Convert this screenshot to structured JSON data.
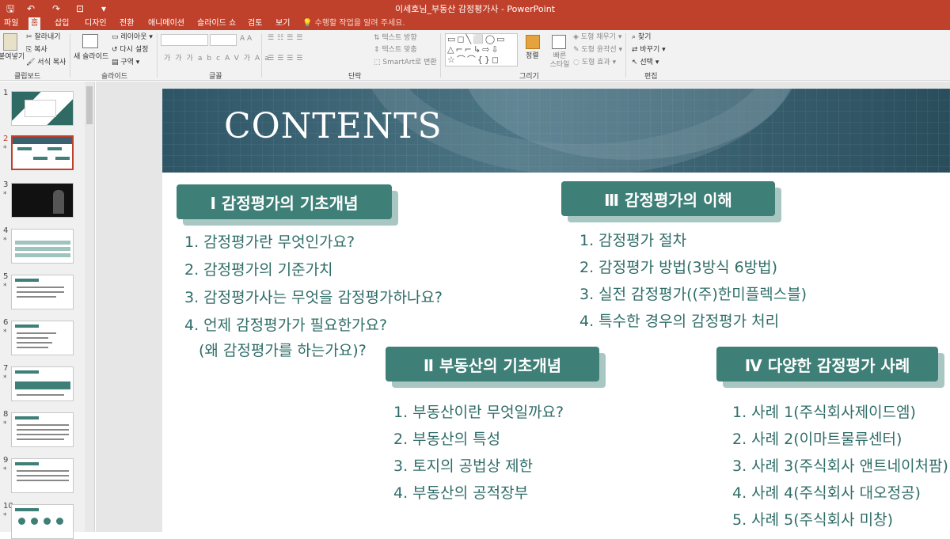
{
  "titlebar": {
    "title": "이세호님_부동산 감정평가사 - PowerPoint",
    "save_icon": "save-icon",
    "undo_icon": "undo-icon",
    "redo_icon": "redo-icon",
    "customize_icon": "customize-icon"
  },
  "tabs": [
    "파일",
    "홈",
    "삽입",
    "디자인",
    "전환",
    "애니메이션",
    "슬라이드 쇼",
    "검토",
    "보기"
  ],
  "tell_me": "수행할 작업을 알려 주세요.",
  "ribbon": {
    "clipboard": {
      "paste": "붙여넣기",
      "cut": "잘라내기",
      "copy": "복사",
      "format_painter": "서식 복사",
      "label": "클립보드"
    },
    "slides": {
      "new_slide": "새 슬라이드",
      "layout": "레이아웃",
      "reset": "다시 설정",
      "section": "구역",
      "label": "슬라이드"
    },
    "font": {
      "label": "글꼴"
    },
    "paragraph": {
      "text_direction": "텍스트 방향",
      "align_text": "텍스트 맞춤",
      "smartart": "SmartArt로 변환",
      "label": "단락"
    },
    "drawing": {
      "arrange": "정렬",
      "quick_styles": "빠른 스타일",
      "shape_fill": "도형 채우기",
      "shape_outline": "도형 윤곽선",
      "shape_effects": "도형 효과",
      "label": "그리기"
    },
    "editing": {
      "find": "찾기",
      "replace": "바꾸기",
      "select": "선택",
      "label": "편집"
    }
  },
  "thumbnails": [
    {
      "num": "1",
      "star": ""
    },
    {
      "num": "2",
      "star": "*"
    },
    {
      "num": "3",
      "star": "*"
    },
    {
      "num": "4",
      "star": "*"
    },
    {
      "num": "5",
      "star": "*"
    },
    {
      "num": "6",
      "star": "*"
    },
    {
      "num": "7",
      "star": "*"
    },
    {
      "num": "8",
      "star": "*"
    },
    {
      "num": "9",
      "star": "*"
    },
    {
      "num": "10",
      "star": "*"
    }
  ],
  "slide": {
    "banner_title": "CONTENTS",
    "sections": [
      {
        "title": "Ⅰ  감정평가의 기초개념",
        "items": [
          "1. 감정평가란 무엇인가요?",
          "2. 감정평가의 기준가치",
          "3. 감정평가사는 무엇을 감정평가하나요?",
          "4. 언제 감정평가가 필요한가요?",
          "(왜 감정평가를 하는가요)?"
        ]
      },
      {
        "title": "Ⅱ  부동산의 기초개념",
        "items": [
          "1. 부동산이란 무엇일까요?",
          "2. 부동산의 특성",
          "3. 토지의 공법상 제한",
          "4. 부동산의 공적장부"
        ]
      },
      {
        "title": "Ⅲ  감정평가의 이해",
        "items": [
          "1. 감정평가 절차",
          "2. 감정평가 방법(3방식 6방법)",
          "3. 실전 감정평가((주)한미플렉스블)",
          "4. 특수한 경우의 감정평가 처리"
        ]
      },
      {
        "title": "Ⅳ  다양한 감정평가 사례",
        "items": [
          "1. 사례 1(주식회사제이드엠)",
          "2. 사례 2(이마트물류센터)",
          "3. 사례 3(주식회사 앤트네이처팜)",
          "4. 사례 4(주식회사 대오정공)",
          "5. 사례 5(주식회사 미창)"
        ]
      }
    ]
  },
  "colors": {
    "accent": "#c0412b",
    "teal": "#3e7f77",
    "teal_text": "#2f6d68",
    "shadow": "#a9c7c2"
  }
}
